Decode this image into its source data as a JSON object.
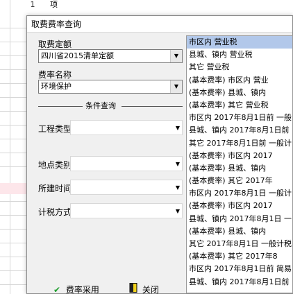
{
  "sheet": {
    "row_number": "1",
    "cell_a1": "项"
  },
  "dialog": {
    "title": "取费费率查询",
    "fee_standard": {
      "label": "取费定额",
      "value": "四川省2015清单定额"
    },
    "rate_name": {
      "label": "费率名称",
      "value": "环境保护"
    },
    "conditions": {
      "title": "条件查询",
      "project_type": {
        "label": "工程类型",
        "value": ""
      },
      "location_type": {
        "label": "地点类别",
        "value": ""
      },
      "build_time": {
        "label": "所建时间",
        "value": ""
      },
      "tax_method": {
        "label": "计税方式",
        "value": ""
      }
    },
    "buttons": {
      "apply": "费率采用",
      "close": "关闭"
    },
    "list": [
      "市区内 营业税",
      "县城、镇内 营业税",
      "其它 营业税",
      "(基本费率) 市区内 营业",
      "(基本费率) 县城、镇内",
      "(基本费率) 其它 营业税",
      "市区内 2017年8月1日前 一般",
      "县城、镇内 2017年8月1日前",
      "其它 2017年8月1日前 一般计",
      "(基本费率) 市区内 2017",
      "(基本费率) 县城、镇内",
      "(基本费率) 其它 2017年",
      "市区内 2017年8月1日 一般计",
      "(基本费率) 市区内 2017",
      "县城、镇内 2017年8月1日 一",
      "(基本费率) 县城、镇内",
      "其它 2017年8月1日 一般计税",
      "(基本费率) 其它 2017年8",
      "市区内 2017年8月1日前 简易",
      "县城、镇内 2017年8月1日前"
    ]
  }
}
